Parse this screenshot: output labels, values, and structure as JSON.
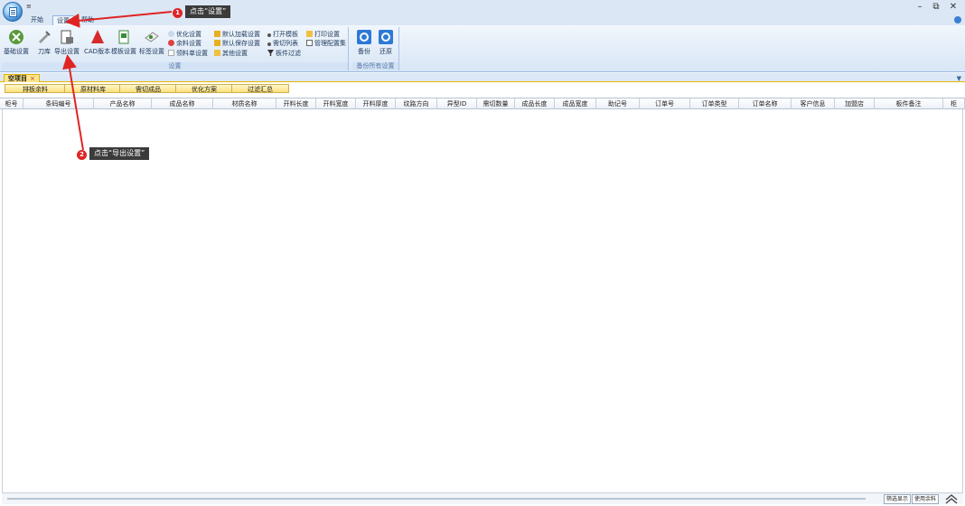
{
  "titlebar": {
    "quick_access": "≡",
    "minimize": "–",
    "restore": "⧉",
    "close": "✕"
  },
  "ribbon_tabs": [
    "开始",
    "设置",
    "帮助"
  ],
  "ribbon": {
    "settings_group": {
      "label": "设置",
      "big_buttons": [
        "基础设置",
        "刀库",
        "导出设置",
        "CAD版本",
        "模板设置",
        "标签设置"
      ],
      "small_col1": [
        "优化设置",
        "余料设置",
        "领料单设置"
      ],
      "small_col2": [
        "默认加载设置",
        "默认保存设置",
        "其他设置"
      ],
      "small_col3": [
        "打开模板",
        "需切列表",
        "板件过滤"
      ],
      "small_col4": [
        "打印设置",
        "管理配置集"
      ]
    },
    "backup_group": {
      "label": "备份所有设置",
      "buttons": [
        "备份",
        "还原"
      ]
    }
  },
  "document_tab": {
    "label": "空项目",
    "close": "×"
  },
  "sub_tabs": [
    "排板余料",
    "原材料库",
    "需切成品",
    "优化方案",
    "过滤汇总"
  ],
  "grid_columns": [
    "柜号",
    "条码编号",
    "产品名称",
    "成品名称",
    "材质名称",
    "开料长度",
    "开料宽度",
    "开料厚度",
    "纹路方向",
    "异型ID",
    "需切数量",
    "成品长度",
    "成品宽度",
    "助记号",
    "订单号",
    "订单类型",
    "订单名称",
    "客户信息",
    "加盟店",
    "板件备注",
    "柜"
  ],
  "footer": {
    "filter_display": "筛选显示",
    "use_remnant": "使用余料"
  },
  "annotations": [
    {
      "num": "1",
      "text": "点击“设置”"
    },
    {
      "num": "2",
      "text": "点击“导出设置”"
    }
  ],
  "colors": {
    "accent_red": "#e02424",
    "ribbon_bg": "#dbe7f5",
    "tab_yellow": "#fde58b"
  }
}
